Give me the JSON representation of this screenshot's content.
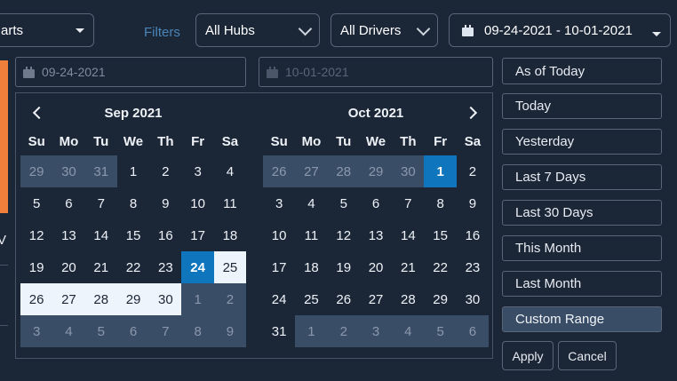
{
  "toolbar": {
    "first_select": "arts",
    "filters_label": "Filters",
    "hubs_select": "All Hubs",
    "drivers_select": "All Drivers",
    "date_range": "09-24-2021 - 10-01-2021"
  },
  "picker": {
    "start_input": "09-24-2021",
    "end_input": "10-01-2021",
    "weekdays": [
      "Su",
      "Mo",
      "Tu",
      "We",
      "Th",
      "Fr",
      "Sa"
    ],
    "left_month": "Sep 2021",
    "right_month": "Oct 2021",
    "left_days": [
      "29",
      "30",
      "31",
      "1",
      "2",
      "3",
      "4",
      "5",
      "6",
      "7",
      "8",
      "9",
      "10",
      "11",
      "12",
      "13",
      "14",
      "15",
      "16",
      "17",
      "18",
      "19",
      "20",
      "21",
      "22",
      "23",
      "24",
      "25",
      "26",
      "27",
      "28",
      "29",
      "30",
      "1",
      "2",
      "3",
      "4",
      "5",
      "6",
      "7",
      "8",
      "9"
    ],
    "right_days": [
      "26",
      "27",
      "28",
      "29",
      "30",
      "1",
      "2",
      "3",
      "4",
      "5",
      "6",
      "7",
      "8",
      "9",
      "10",
      "11",
      "12",
      "13",
      "14",
      "15",
      "16",
      "17",
      "18",
      "19",
      "20",
      "21",
      "22",
      "23",
      "24",
      "25",
      "26",
      "27",
      "28",
      "29",
      "30",
      "31",
      "1",
      "2",
      "3",
      "4",
      "5",
      "6"
    ],
    "ranges": [
      "As of Today",
      "Today",
      "Yesterday",
      "Last 7 Days",
      "Last 30 Days",
      "This Month",
      "Last Month",
      "Custom Range"
    ],
    "apply_label": "Apply",
    "cancel_label": "Cancel"
  },
  "side": {
    "stub_letter": "V"
  },
  "colors": {
    "accent": "#0f76be",
    "background": "#1b2637",
    "range_fill": "#eef4fb",
    "other_month": "#3a4d67",
    "orange_strip": "#f07f3c"
  }
}
